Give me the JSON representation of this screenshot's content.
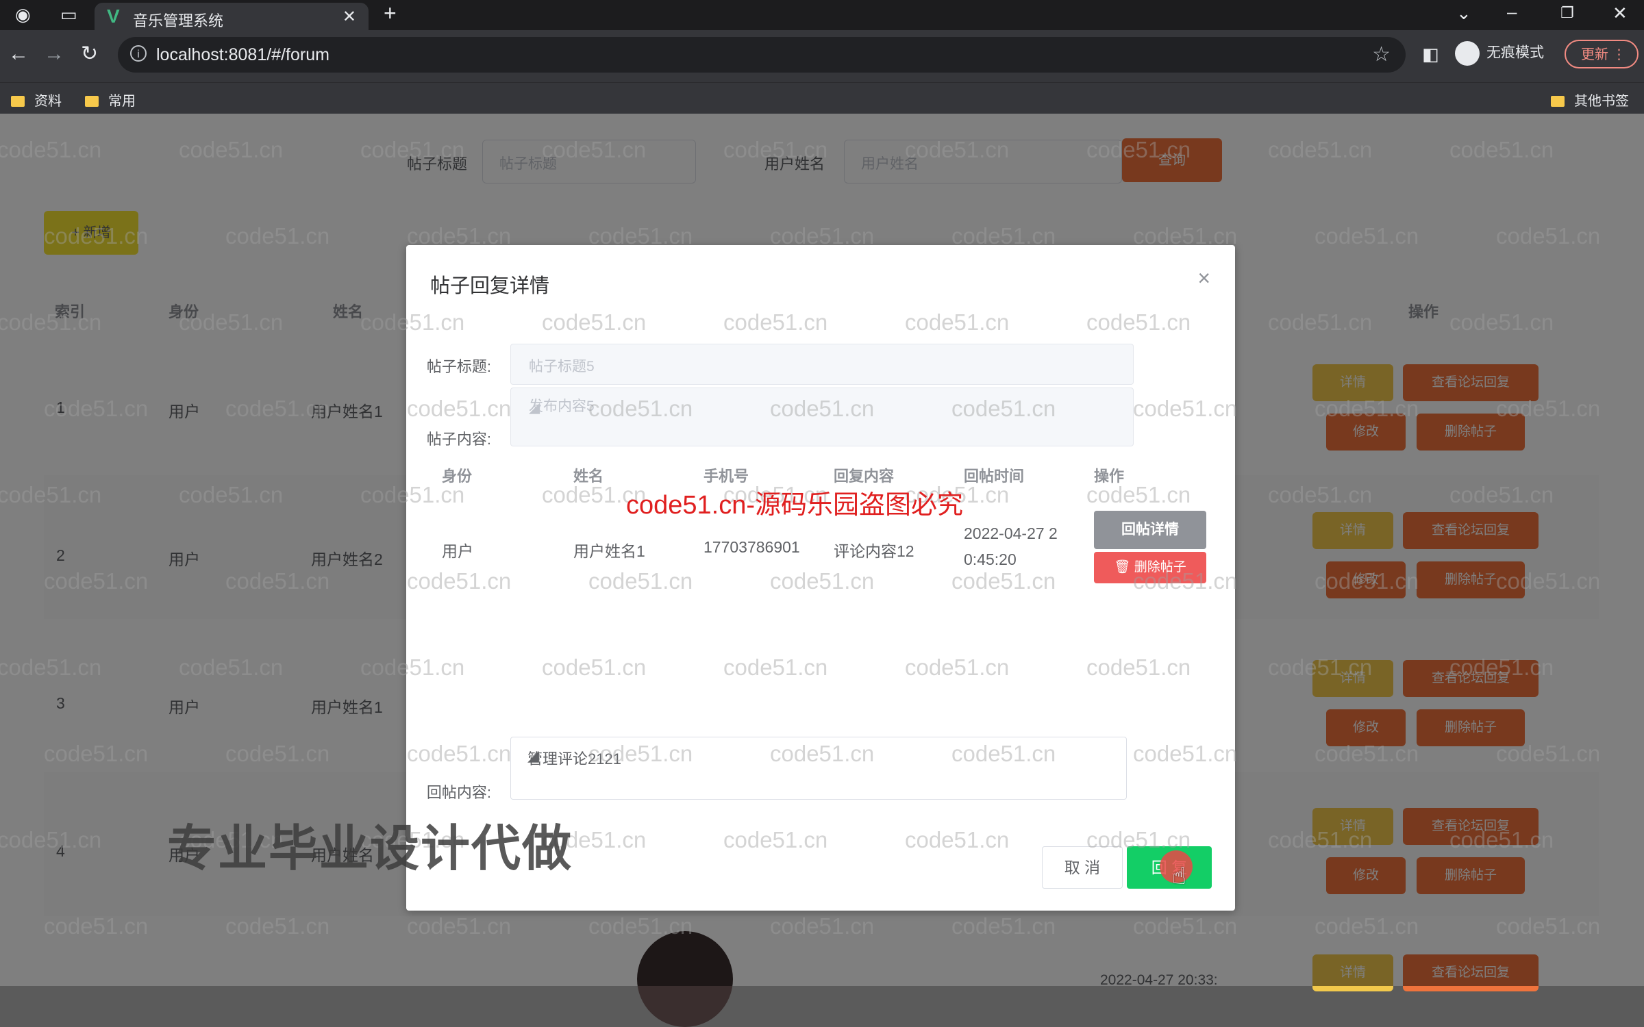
{
  "browser": {
    "tab_title": "音乐管理系统",
    "url": "localhost:8081/#/forum",
    "incognito_label": "无痕模式",
    "update_label": "更新",
    "bookmarks": [
      "资料",
      "常用"
    ],
    "other_bookmarks": "其他书签"
  },
  "page": {
    "search": {
      "title_label": "帖子标题",
      "title_placeholder": "帖子标题",
      "user_label": "用户姓名",
      "user_placeholder": "用户姓名",
      "query_button": "查询"
    },
    "add_button": "+ 新增",
    "table_headers": {
      "index": "索引",
      "identity": "身份",
      "name": "姓名",
      "actions": "操作"
    },
    "rows": [
      {
        "index": "1",
        "identity": "用户",
        "name": "用户姓名1"
      },
      {
        "index": "2",
        "identity": "用户",
        "name": "用户姓名2"
      },
      {
        "index": "3",
        "identity": "用户",
        "name": "用户姓名1"
      },
      {
        "index": "4",
        "identity": "用户",
        "name": "用户姓名"
      }
    ],
    "row_actions": {
      "detail": "详情",
      "view_replies": "查看论坛回复",
      "edit": "修改",
      "delete": "删除帖子"
    },
    "partial_time": "2022-04-27 20:33:"
  },
  "dialog": {
    "title": "帖子回复详情",
    "post_title_label": "帖子标题:",
    "post_title_value": "帖子标题5",
    "post_content_label": "帖子内容:",
    "post_content_value": "发布内容5",
    "reply_table": {
      "headers": [
        "身份",
        "姓名",
        "手机号",
        "回复内容",
        "回帖时间",
        "操作"
      ],
      "rows": [
        {
          "identity": "用户",
          "name": "用户姓名1",
          "phone": "17703786901",
          "content": "评论内容12",
          "time_line1": "2022-04-27 2",
          "time_line2": "0:45:20"
        }
      ],
      "detail_button": "回帖详情",
      "delete_button": "删除帖子"
    },
    "reply_label": "回帖内容:",
    "reply_value": "管理评论2121",
    "cancel_button": "取 消",
    "submit_button": "回 复"
  },
  "watermarks": {
    "site": "code51.cn",
    "red_notice": "code51.cn-源码乐园盗图必究",
    "big_text": "专业毕业设计代做"
  },
  "colors": {
    "success": "#13ce66",
    "danger": "#ef5b5b",
    "warning": "#f2c94c",
    "orange": "#f0733c"
  }
}
